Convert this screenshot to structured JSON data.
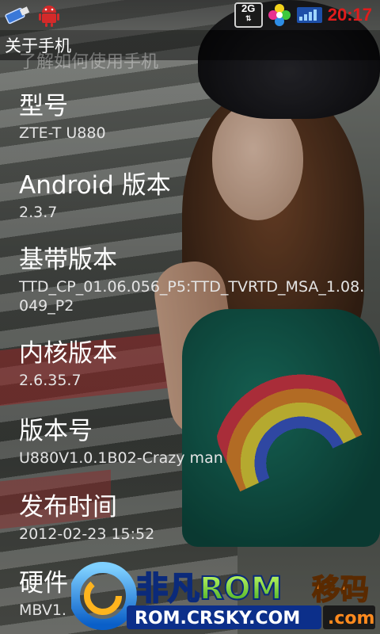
{
  "status_bar": {
    "network_badge": "2G",
    "time": "20:17",
    "icons": [
      "usb-debug-icon",
      "android-icon",
      "network-2g-icon",
      "flower-app-icon",
      "signal-icon"
    ],
    "clock_color": "#e01c1c"
  },
  "title_bar": {
    "title": "关于手机"
  },
  "list": {
    "partial_item": "了解如何使用手机",
    "items": [
      {
        "title": "型号",
        "summary": "ZTE-T U880"
      },
      {
        "title": "Android 版本",
        "summary": "2.3.7"
      },
      {
        "title": "基带版本",
        "summary": "TTD_CP_01.06.056_P5:TTD_TVRTD_MSA_1.08.049_P2"
      },
      {
        "title": "内核版本",
        "summary": "2.6.35.7"
      },
      {
        "title": "版本号",
        "summary": "U880V1.0.1B02-Crazy man"
      },
      {
        "title": "发布时间",
        "summary": "2012-02-23  15:52"
      },
      {
        "title": "硬件",
        "summary": "MBV1."
      }
    ]
  },
  "watermark": {
    "brand": "非凡ROM",
    "url": "ROM.CRSKY.COM",
    "suffix": "移码",
    "suffix_sub": ".com"
  }
}
